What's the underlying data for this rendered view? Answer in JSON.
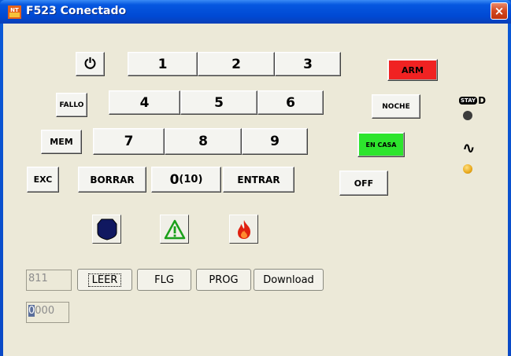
{
  "window": {
    "title": "F523 Conectado",
    "close": "×"
  },
  "keypad": {
    "power": "⏻",
    "fallo": "FALLO",
    "mem": "MEM",
    "exc": "EXC",
    "borrar": "BORRAR",
    "zero_main": "0",
    "zero_sub": "(10)",
    "entrar": "ENTRAR",
    "k1": "1",
    "k2": "2",
    "k3": "3",
    "k4": "4",
    "k5": "5",
    "k6": "6",
    "k7": "7",
    "k8": "8",
    "k9": "9"
  },
  "modes": {
    "arm": "ARM",
    "noche": "NOCHE",
    "encasa": "EN CASA",
    "off": "OFF"
  },
  "indicators": {
    "stay_badge": "STAY",
    "stay_d": "D",
    "ac_symbol": "∿",
    "colors": {
      "stay_led": "#3c3c3c",
      "ac_led": "#e8a81a"
    }
  },
  "bottom": {
    "account_value": "811",
    "code_caret": "0",
    "code_rest": "000",
    "leer": "LEER",
    "flg": "FLG",
    "prog": "PROG",
    "download": "Download"
  },
  "colors": {
    "arm": "#f02222",
    "encasa": "#2de52d",
    "shield": "#101860",
    "warning": "#1aa01a",
    "fire": "#e02010"
  }
}
